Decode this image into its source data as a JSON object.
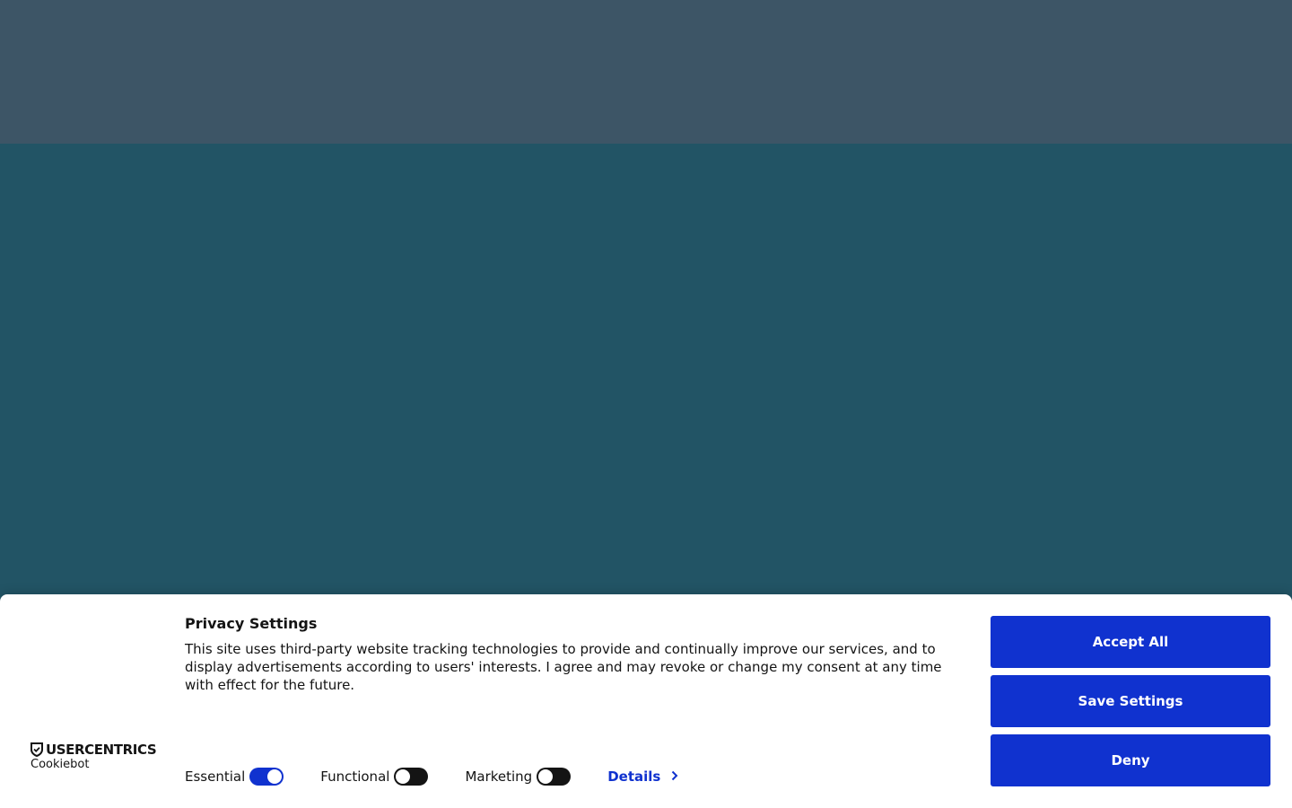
{
  "banner": {
    "title": "Privacy Settings",
    "description": "This site uses third-party website tracking technologies to provide and continually improve our services, and to display advertisements according to users' interests. I agree and may revoke or change my consent at any time with effect for the future.",
    "brand": {
      "name": "USERCENTRICS",
      "product": "Cookiebot",
      "icon": "shield-check-icon"
    },
    "toggles": [
      {
        "label": "Essential",
        "checked": true
      },
      {
        "label": "Functional",
        "checked": false
      },
      {
        "label": "Marketing",
        "checked": false
      }
    ],
    "details_label": "Details",
    "buttons": {
      "accept_all": "Accept All",
      "save_settings": "Save Settings",
      "deny": "Deny"
    }
  },
  "colors": {
    "accent": "#1032cf",
    "top_band": "#3d5566",
    "backdrop": "#225465",
    "text": "#141414"
  }
}
